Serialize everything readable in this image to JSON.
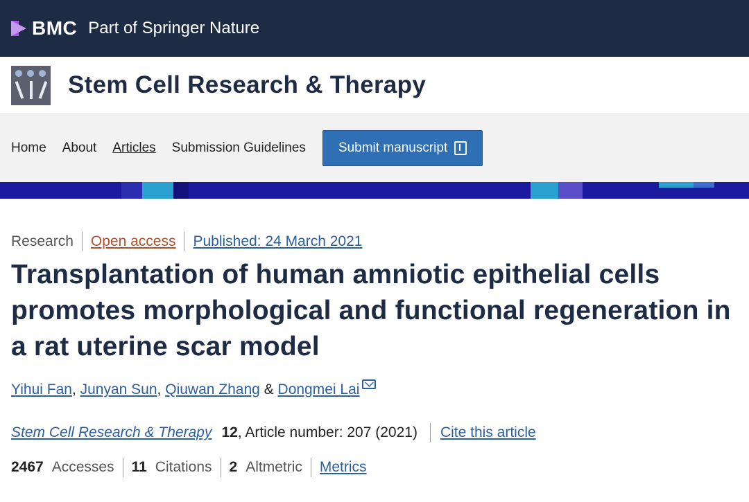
{
  "topbar": {
    "brand": "BMC",
    "tagline": "Part of Springer Nature"
  },
  "journal": {
    "name": "Stem Cell Research & Therapy"
  },
  "nav": {
    "items": [
      "Home",
      "About",
      "Articles",
      "Submission Guidelines"
    ],
    "submit_label": "Submit manuscript"
  },
  "article": {
    "type": "Research",
    "access": "Open access",
    "published": "Published: 24 March 2021",
    "title": "Transplantation of human amniotic epithelial cells promotes morphological and functional regeneration in a rat uterine scar model",
    "authors": [
      "Yihui Fan",
      "Junyan Sun",
      "Qiuwan Zhang",
      "Dongmei Lai"
    ],
    "author_sep_1": ",",
    "author_sep_2": ",",
    "author_amp": "&",
    "journal_ref": "Stem Cell Research & Therapy",
    "volume": "12",
    "article_number": ", Article number: 207 (2021)",
    "cite_label": "Cite this article"
  },
  "metrics": {
    "accesses_value": "2467",
    "accesses_label": "Accesses",
    "citations_value": "11",
    "citations_label": "Citations",
    "altmetric_value": "2",
    "altmetric_label": "Altmetric",
    "metrics_link": "Metrics"
  },
  "colors": {
    "topbar": "#1e2b45",
    "accent": "#2c5f9e",
    "open_access": "#b2522c",
    "stripe": "#1c1a9e"
  },
  "icons": {
    "brand": "bmc-logo-icon",
    "journal": "journal-logo-icon",
    "submit": "external-link-icon",
    "mail": "mail-icon"
  }
}
